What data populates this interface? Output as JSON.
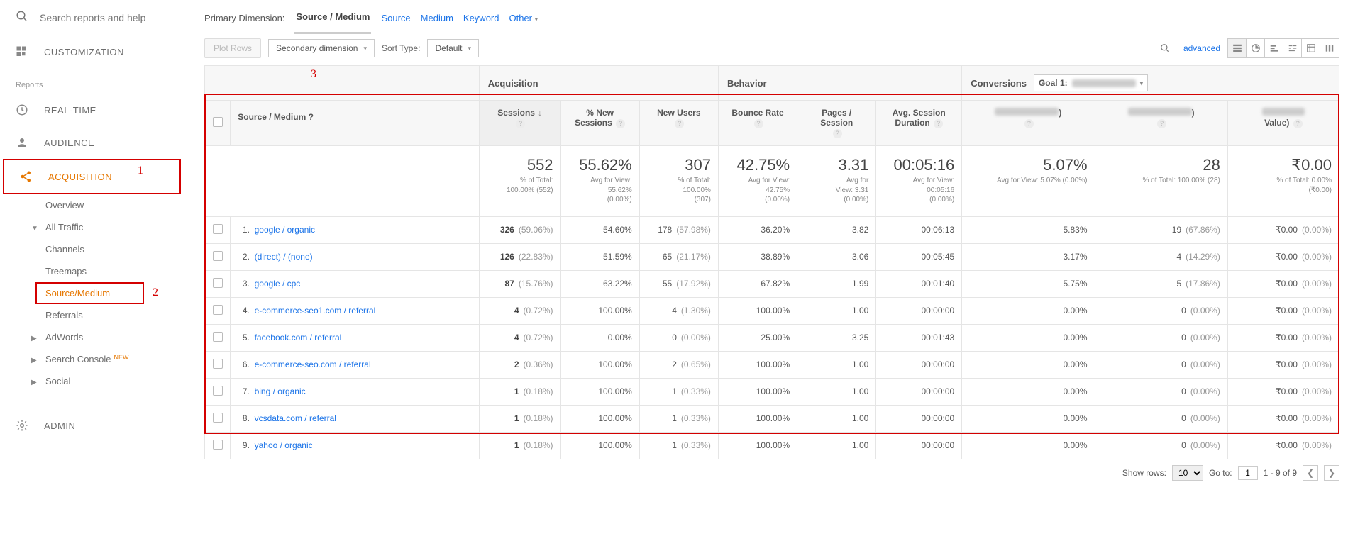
{
  "search": {
    "placeholder": "Search reports and help"
  },
  "sidebar": {
    "customization": "CUSTOMIZATION",
    "reports_label": "Reports",
    "realtime": "REAL-TIME",
    "audience": "AUDIENCE",
    "acquisition": "ACQUISITION",
    "admin": "ADMIN",
    "sub": {
      "overview": "Overview",
      "all_traffic": "All Traffic",
      "channels": "Channels",
      "treemaps": "Treemaps",
      "source_medium": "Source/Medium",
      "referrals": "Referrals",
      "adwords": "AdWords",
      "search_console": "Search Console",
      "social": "Social",
      "new_badge": "NEW"
    }
  },
  "annotations": {
    "a1": "1",
    "a2": "2",
    "a3": "3"
  },
  "dimbar": {
    "label": "Primary Dimension:",
    "active": "Source / Medium",
    "source": "Source",
    "medium": "Medium",
    "keyword": "Keyword",
    "other": "Other"
  },
  "toolbar": {
    "plot_rows": "Plot Rows",
    "sec_dim": "Secondary dimension",
    "sort_type": "Sort Type:",
    "sort_default": "Default",
    "advanced": "advanced"
  },
  "table": {
    "group_acq": "Acquisition",
    "group_beh": "Behavior",
    "group_conv": "Conversions",
    "goal_prefix": "Goal 1:",
    "src_med": "Source / Medium",
    "cols": {
      "sessions": "Sessions",
      "new_sessions": "% New Sessions",
      "new_users": "New Users",
      "bounce": "Bounce Rate",
      "pps": "Pages / Session",
      "avg_dur": "Avg. Session Duration",
      "goal_val": "Value)"
    },
    "totals": {
      "sessions": {
        "v": "552",
        "s1": "% of Total:",
        "s2": "100.00% (552)"
      },
      "new_sessions": {
        "v": "55.62%",
        "s1": "Avg for View:",
        "s2": "55.62%",
        "s3": "(0.00%)"
      },
      "new_users": {
        "v": "307",
        "s1": "% of Total:",
        "s2": "100.00%",
        "s3": "(307)"
      },
      "bounce": {
        "v": "42.75%",
        "s1": "Avg for View:",
        "s2": "42.75%",
        "s3": "(0.00%)"
      },
      "pps": {
        "v": "3.31",
        "s1": "Avg for",
        "s2": "View: 3.31",
        "s3": "(0.00%)"
      },
      "avg_dur": {
        "v": "00:05:16",
        "s1": "Avg for View:",
        "s2": "00:05:16",
        "s3": "(0.00%)"
      },
      "goal_rate": {
        "v": "5.07%",
        "s": "Avg for View: 5.07% (0.00%)"
      },
      "goal_comp": {
        "v": "28",
        "s": "% of Total: 100.00% (28)"
      },
      "goal_val": {
        "v": "₹0.00",
        "s1": "% of Total: 0.00%",
        "s2": "(₹0.00)"
      }
    },
    "rows": [
      {
        "n": "1.",
        "src": "google / organic",
        "s": "326",
        "spct": "(59.06%)",
        "ns": "54.60%",
        "nu": "178",
        "nupct": "(57.98%)",
        "b": "36.20%",
        "pps": "3.82",
        "d": "00:06:13",
        "gr": "5.83%",
        "gc": "19",
        "gcpct": "(67.86%)",
        "gv": "₹0.00",
        "gvpct": "(0.00%)"
      },
      {
        "n": "2.",
        "src": "(direct) / (none)",
        "s": "126",
        "spct": "(22.83%)",
        "ns": "51.59%",
        "nu": "65",
        "nupct": "(21.17%)",
        "b": "38.89%",
        "pps": "3.06",
        "d": "00:05:45",
        "gr": "3.17%",
        "gc": "4",
        "gcpct": "(14.29%)",
        "gv": "₹0.00",
        "gvpct": "(0.00%)"
      },
      {
        "n": "3.",
        "src": "google / cpc",
        "s": "87",
        "spct": "(15.76%)",
        "ns": "63.22%",
        "nu": "55",
        "nupct": "(17.92%)",
        "b": "67.82%",
        "pps": "1.99",
        "d": "00:01:40",
        "gr": "5.75%",
        "gc": "5",
        "gcpct": "(17.86%)",
        "gv": "₹0.00",
        "gvpct": "(0.00%)"
      },
      {
        "n": "4.",
        "src": "e-commerce-seo1.com / referral",
        "s": "4",
        "spct": "(0.72%)",
        "ns": "100.00%",
        "nu": "4",
        "nupct": "(1.30%)",
        "b": "100.00%",
        "pps": "1.00",
        "d": "00:00:00",
        "gr": "0.00%",
        "gc": "0",
        "gcpct": "(0.00%)",
        "gv": "₹0.00",
        "gvpct": "(0.00%)"
      },
      {
        "n": "5.",
        "src": "facebook.com / referral",
        "s": "4",
        "spct": "(0.72%)",
        "ns": "0.00%",
        "nu": "0",
        "nupct": "(0.00%)",
        "b": "25.00%",
        "pps": "3.25",
        "d": "00:01:43",
        "gr": "0.00%",
        "gc": "0",
        "gcpct": "(0.00%)",
        "gv": "₹0.00",
        "gvpct": "(0.00%)"
      },
      {
        "n": "6.",
        "src": "e-commerce-seo.com / referral",
        "s": "2",
        "spct": "(0.36%)",
        "ns": "100.00%",
        "nu": "2",
        "nupct": "(0.65%)",
        "b": "100.00%",
        "pps": "1.00",
        "d": "00:00:00",
        "gr": "0.00%",
        "gc": "0",
        "gcpct": "(0.00%)",
        "gv": "₹0.00",
        "gvpct": "(0.00%)"
      },
      {
        "n": "7.",
        "src": "bing / organic",
        "s": "1",
        "spct": "(0.18%)",
        "ns": "100.00%",
        "nu": "1",
        "nupct": "(0.33%)",
        "b": "100.00%",
        "pps": "1.00",
        "d": "00:00:00",
        "gr": "0.00%",
        "gc": "0",
        "gcpct": "(0.00%)",
        "gv": "₹0.00",
        "gvpct": "(0.00%)"
      },
      {
        "n": "8.",
        "src": "vcsdata.com / referral",
        "s": "1",
        "spct": "(0.18%)",
        "ns": "100.00%",
        "nu": "1",
        "nupct": "(0.33%)",
        "b": "100.00%",
        "pps": "1.00",
        "d": "00:00:00",
        "gr": "0.00%",
        "gc": "0",
        "gcpct": "(0.00%)",
        "gv": "₹0.00",
        "gvpct": "(0.00%)"
      },
      {
        "n": "9.",
        "src": "yahoo / organic",
        "s": "1",
        "spct": "(0.18%)",
        "ns": "100.00%",
        "nu": "1",
        "nupct": "(0.33%)",
        "b": "100.00%",
        "pps": "1.00",
        "d": "00:00:00",
        "gr": "0.00%",
        "gc": "0",
        "gcpct": "(0.00%)",
        "gv": "₹0.00",
        "gvpct": "(0.00%)"
      }
    ]
  },
  "pager": {
    "show_rows": "Show rows:",
    "rows_val": "10",
    "goto": "Go to:",
    "goto_val": "1",
    "range": "1 - 9 of 9"
  }
}
